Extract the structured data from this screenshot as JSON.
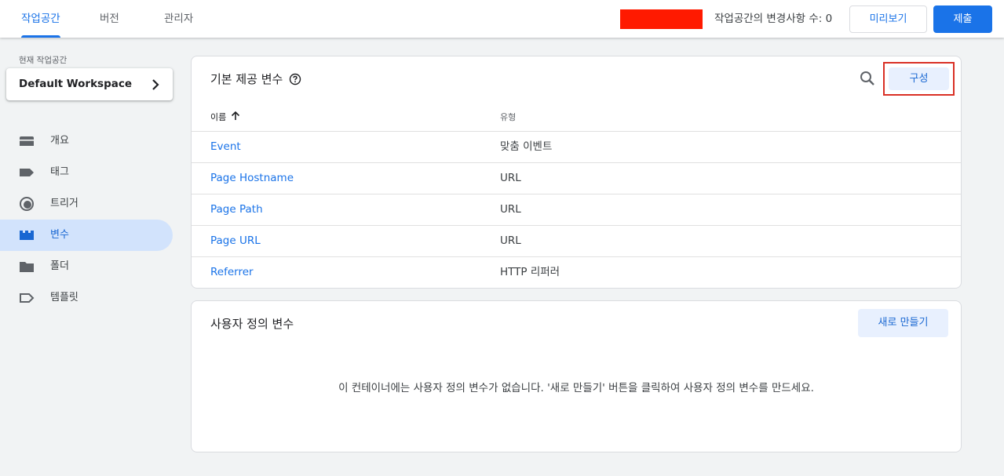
{
  "topbar": {
    "tabs": [
      {
        "label": "작업공간",
        "active": true
      },
      {
        "label": "버전",
        "active": false
      },
      {
        "label": "관리자",
        "active": false
      }
    ],
    "changes_text": "작업공간의 변경사항 수: 0",
    "preview_label": "미리보기",
    "submit_label": "제출"
  },
  "sidebar": {
    "workspace_label": "현재 작업공간",
    "workspace_name": "Default Workspace",
    "items": [
      {
        "label": "개요",
        "icon": "overview-icon",
        "active": false
      },
      {
        "label": "태그",
        "icon": "tag-icon",
        "active": false
      },
      {
        "label": "트리거",
        "icon": "trigger-icon",
        "active": false
      },
      {
        "label": "변수",
        "icon": "variable-icon",
        "active": true
      },
      {
        "label": "폴더",
        "icon": "folder-icon",
        "active": false
      },
      {
        "label": "템플릿",
        "icon": "template-icon",
        "active": false
      }
    ]
  },
  "builtin": {
    "title": "기본 제공 변수",
    "config_label": "구성",
    "columns": {
      "name": "이름",
      "type": "유형"
    },
    "rows": [
      {
        "name": "Event",
        "type": "맞춤 이벤트"
      },
      {
        "name": "Page Hostname",
        "type": "URL"
      },
      {
        "name": "Page Path",
        "type": "URL"
      },
      {
        "name": "Page URL",
        "type": "URL"
      },
      {
        "name": "Referrer",
        "type": "HTTP 리퍼러"
      }
    ]
  },
  "user_defined": {
    "title": "사용자 정의 변수",
    "new_label": "새로 만들기",
    "empty_message": "이 컨테이너에는 사용자 정의 변수가 없습니다. '새로 만들기' 버튼을 클릭하여 사용자 정의 변수를 만드세요."
  },
  "colors": {
    "accent": "#1a73e8",
    "active_nav_bg": "#d2e3fc",
    "highlight_border": "#d93025",
    "redaction": "#ff1a00"
  }
}
